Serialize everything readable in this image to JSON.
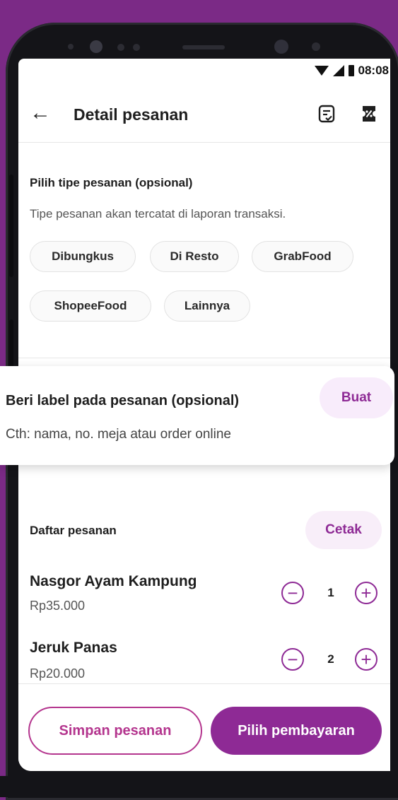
{
  "status_bar": {
    "time": "08:08"
  },
  "header": {
    "title": "Detail pesanan",
    "back_icon": "arrow-left-icon",
    "note_icon": "note-check-icon",
    "ticket_icon": "discount-ticket-icon"
  },
  "order_type": {
    "heading": "Pilih tipe pesanan (opsional)",
    "subtitle": "Tipe pesanan akan tercatat di laporan transaksi.",
    "chips": [
      "Dibungkus",
      "Di Resto",
      "GrabFood",
      "ShopeeFood",
      "Lainnya"
    ]
  },
  "label_card": {
    "heading": "Beri label pada pesanan (opsional)",
    "hint": "Cth: nama, no. meja atau order online",
    "button": "Buat"
  },
  "order_list": {
    "heading": "Daftar pesanan",
    "print_button": "Cetak",
    "items": [
      {
        "name": "Nasgor Ayam Kampung",
        "price": "Rp35.000",
        "qty": "1"
      },
      {
        "name": "Jeruk Panas",
        "price": "Rp20.000",
        "qty": "2"
      }
    ]
  },
  "footer": {
    "save_button": "Simpan pesanan",
    "pay_button": "Pilih pembayaran"
  },
  "colors": {
    "accent": "#8e2a95",
    "accent_light": "#f8ecfb",
    "outline": "#b4358e",
    "background": "#7b2a86"
  }
}
